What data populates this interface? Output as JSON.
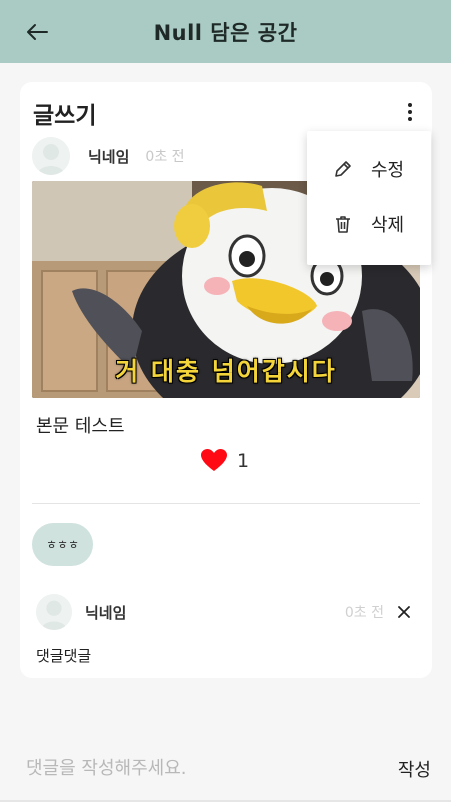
{
  "appbar": {
    "title": "Null 담은 공간",
    "back_icon": "arrow-left-icon"
  },
  "post": {
    "section_title": "글쓰기",
    "author": {
      "nickname": "닉네임",
      "time": "0초 전"
    },
    "image": {
      "caption": "거 대충 넘어갑시다"
    },
    "body": "본문 테스트",
    "likes": {
      "count": "1",
      "icon": "heart-icon",
      "color": "#ff0a14"
    }
  },
  "menu": {
    "items": [
      {
        "label": "수정",
        "icon": "pencil-icon"
      },
      {
        "label": "삭제",
        "icon": "trash-icon"
      }
    ]
  },
  "tag": {
    "label": "ㅎㅎㅎ"
  },
  "comment": {
    "nickname": "닉네임",
    "time": "0초 전",
    "text": "댓글댓글",
    "delete_icon": "close-icon"
  },
  "composer": {
    "placeholder": "댓글을 작성해주세요.",
    "submit_label": "작성"
  },
  "colors": {
    "appbar": "#a9cbc3",
    "chip": "#cfe2dd",
    "background": "#f6f6f6"
  }
}
